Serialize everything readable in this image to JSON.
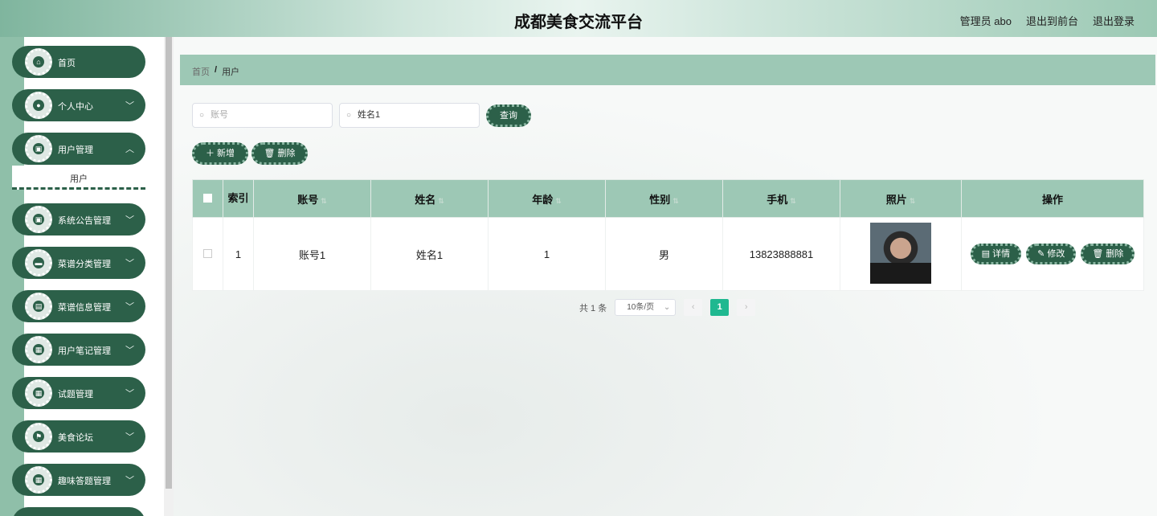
{
  "header": {
    "title": "成都美食交流平台",
    "admin": "管理员 abo",
    "to_front": "退出到前台",
    "logout": "退出登录"
  },
  "sidebar": {
    "items": [
      {
        "label": "首页",
        "icon": "home-icon",
        "glyph": "⌂",
        "chevron": false
      },
      {
        "label": "个人中心",
        "icon": "user-icon",
        "glyph": "●",
        "chevron": true
      },
      {
        "label": "用户管理",
        "icon": "clipboard-icon",
        "glyph": "▣",
        "chevron": true
      },
      {
        "label": "系统公告管理",
        "icon": "clipboard-icon",
        "glyph": "▣",
        "chevron": true
      },
      {
        "label": "菜谱分类管理",
        "icon": "briefcase-icon",
        "glyph": "▬",
        "chevron": true
      },
      {
        "label": "菜谱信息管理",
        "icon": "document-icon",
        "glyph": "▤",
        "chevron": true
      },
      {
        "label": "用户笔记管理",
        "icon": "grid-icon",
        "glyph": "▦",
        "chevron": true
      },
      {
        "label": "试题管理",
        "icon": "grid-icon",
        "glyph": "▦",
        "chevron": true
      },
      {
        "label": "美食论坛",
        "icon": "flag-icon",
        "glyph": "⚑",
        "chevron": true
      },
      {
        "label": "趣味答题管理",
        "icon": "grid-icon",
        "glyph": "▦",
        "chevron": true
      }
    ],
    "submenu_user": "用户"
  },
  "breadcrumb": {
    "home": "首页",
    "sep": "/",
    "current": "用户"
  },
  "search": {
    "account_placeholder": "账号",
    "name_value": "姓名1",
    "query_button": "查询"
  },
  "actions": {
    "add": "新增",
    "delete": "删除"
  },
  "table": {
    "headers": [
      "索引",
      "账号",
      "姓名",
      "年龄",
      "性别",
      "手机",
      "照片",
      "操作"
    ],
    "rows": [
      {
        "index": "1",
        "account": "账号1",
        "name": "姓名1",
        "age": "1",
        "gender": "男",
        "phone": "13823888881"
      }
    ],
    "op_detail": "详情",
    "op_edit": "修改",
    "op_delete": "删除"
  },
  "pagination": {
    "total": "共 1 条",
    "page_size": "10条/页",
    "current_page": "1"
  },
  "colors": {
    "accent_dark": "#2c6049",
    "accent_light": "#9dc8b5",
    "page_active": "#1fb890"
  }
}
